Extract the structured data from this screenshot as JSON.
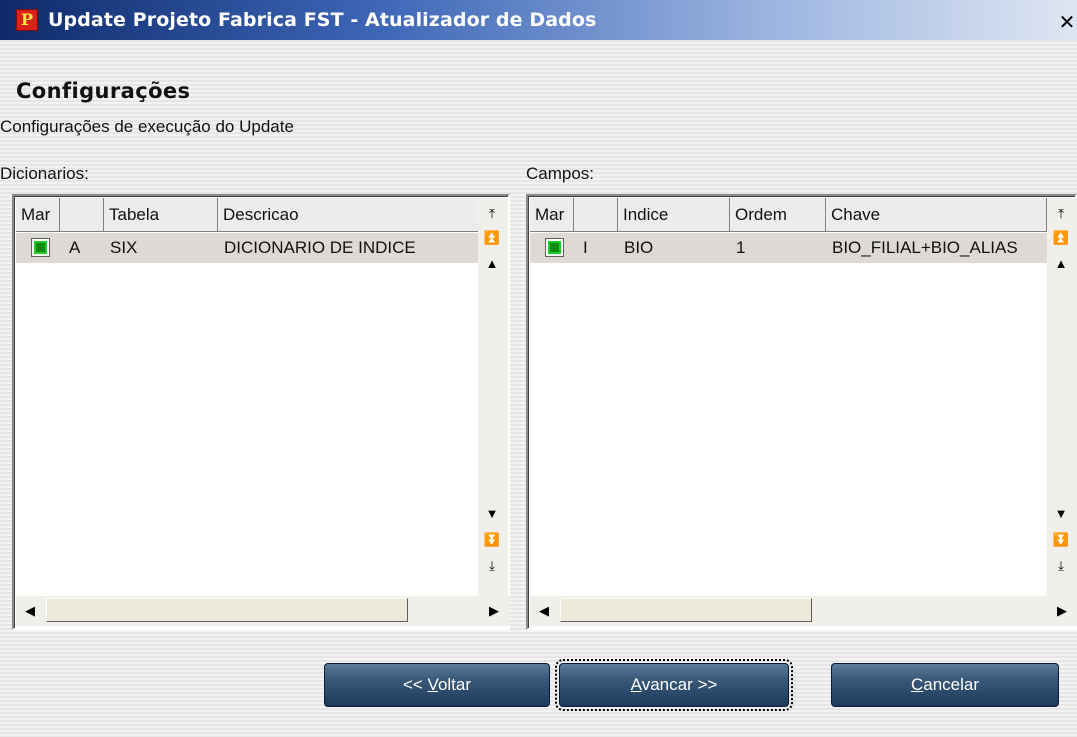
{
  "window": {
    "title": "Update Projeto Fabrica FST - Atualizador de Dados",
    "icon": "app-logo-icon",
    "close_glyph": "✕"
  },
  "header": {
    "title": "Configurações",
    "subtitle": "Configurações de execução do Update"
  },
  "dicionarios": {
    "label": "Dicionarios:",
    "columns": [
      "Mar",
      "",
      "Tabela",
      "Descricao"
    ],
    "rows": [
      {
        "checked": true,
        "flag": "A",
        "tabela": "SIX",
        "descricao": "DICIONARIO DE INDICE"
      }
    ]
  },
  "campos": {
    "label": "Campos:",
    "columns": [
      "Mar",
      "",
      "Indice",
      "Ordem",
      "Chave"
    ],
    "rows": [
      {
        "checked": true,
        "flag": "I",
        "indice": "BIO",
        "ordem": "1",
        "chave": "BIO_FILIAL+BIO_ALIAS"
      }
    ]
  },
  "buttons": {
    "voltar_prefix": "<< ",
    "voltar_hotkey": "V",
    "voltar_rest": "oltar",
    "avancar_hotkey": "A",
    "avancar_rest": "vancar >>",
    "cancelar_hotkey": "C",
    "cancelar_rest": "ancelar"
  },
  "colors": {
    "checkbox": "#1bcd22",
    "button": "#2c4a6c"
  }
}
